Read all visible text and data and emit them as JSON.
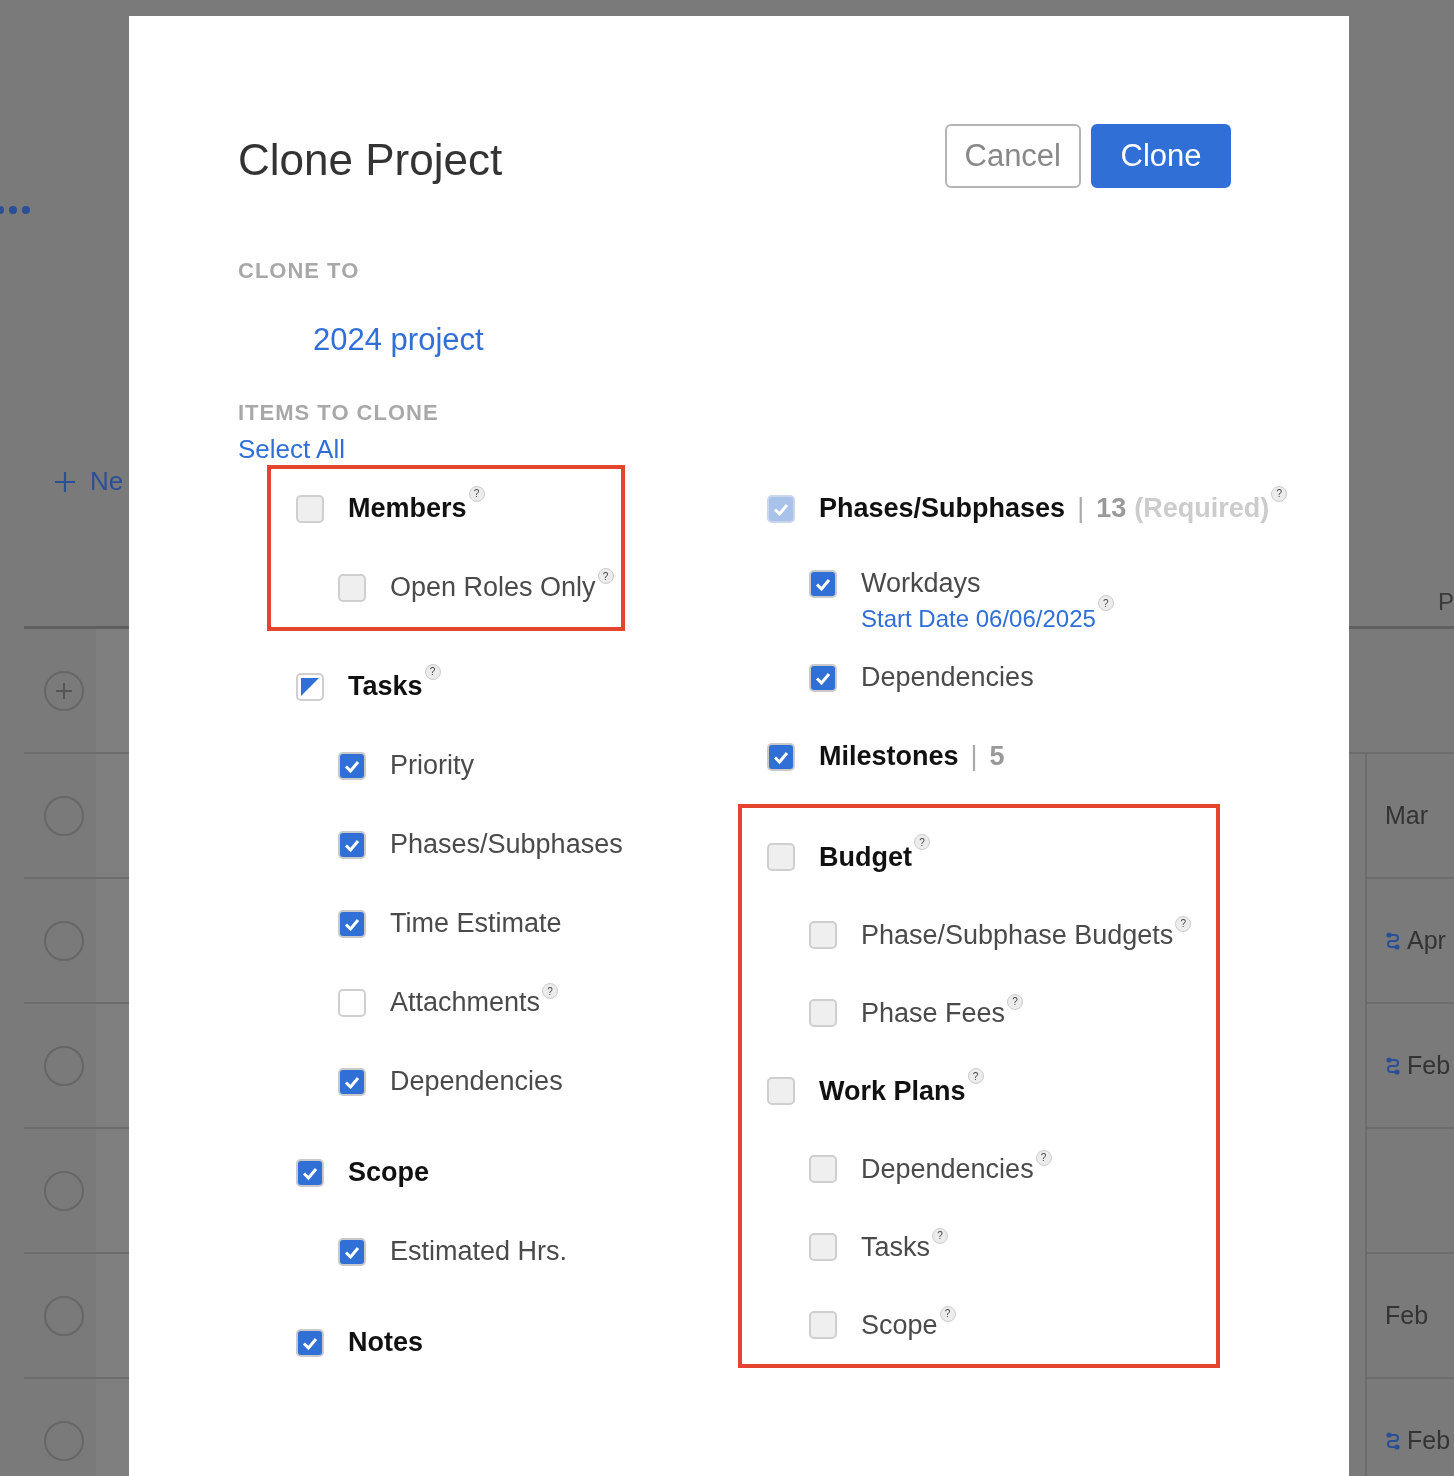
{
  "background": {
    "new_button": {
      "label": "Ne"
    },
    "column_header": "P",
    "rows": [
      {
        "add": true,
        "cell": "",
        "linked": false
      },
      {
        "add": false,
        "cell": "Mar",
        "linked": false
      },
      {
        "add": false,
        "cell": "Apr",
        "linked": true
      },
      {
        "add": false,
        "cell": "Feb",
        "linked": true
      },
      {
        "add": false,
        "cell": "",
        "linked": false
      },
      {
        "add": false,
        "cell": "Feb",
        "linked": false
      },
      {
        "add": false,
        "cell": "Feb",
        "linked": true
      }
    ]
  },
  "dialog": {
    "title": "Clone Project",
    "buttons": [
      {
        "label": "Cancel",
        "kind": "secondary"
      },
      {
        "label": "Clone",
        "kind": "primary"
      }
    ],
    "clone_to": {
      "heading": "CLONE TO",
      "value": "2024 project"
    },
    "items_heading": "ITEMS TO CLONE",
    "select_all": "Select All",
    "columns": [
      [
        {
          "highlighted": true,
          "groups": [
            {
              "label": "Members",
              "checked": false,
              "disabled": true,
              "help": "?",
              "children": [
                {
                  "label": "Open Roles Only",
                  "checked": false,
                  "disabled": true,
                  "help": "?"
                }
              ]
            }
          ]
        },
        {
          "highlighted": false,
          "groups": [
            {
              "label": "Tasks",
              "checked": true,
              "partial": true,
              "disabled": false,
              "help": "?",
              "children": [
                {
                  "label": "Priority",
                  "checked": true,
                  "disabled": false
                },
                {
                  "label": "Phases/Subphases",
                  "checked": true,
                  "disabled": false
                },
                {
                  "label": "Time Estimate",
                  "checked": true,
                  "disabled": false
                },
                {
                  "label": "Attachments",
                  "checked": false,
                  "disabled": false,
                  "help": "?"
                },
                {
                  "label": "Dependencies",
                  "checked": true,
                  "disabled": false
                }
              ]
            },
            {
              "label": "Scope",
              "checked": true,
              "disabled": false,
              "children": [
                {
                  "label": "Estimated Hrs.",
                  "checked": true,
                  "disabled": false
                }
              ]
            },
            {
              "label": "Notes",
              "checked": true,
              "disabled": false
            }
          ]
        }
      ],
      [
        {
          "highlighted": false,
          "groups": [
            {
              "label": "Phases/Subphases",
              "checked": true,
              "disabled": true,
              "separator": "|",
              "count": "13",
              "note": "(Required)",
              "help": "?",
              "children": [
                {
                  "label": "Workdays",
                  "checked": true,
                  "disabled": false,
                  "link": "Start Date 06/06/2025",
                  "link_help": "?"
                },
                {
                  "label": "Dependencies",
                  "checked": true,
                  "disabled": false
                }
              ]
            },
            {
              "label": "Milestones",
              "checked": true,
              "disabled": false,
              "separator": "|",
              "count": "5"
            }
          ]
        },
        {
          "highlighted": true,
          "groups": [
            {
              "label": "Budget",
              "checked": false,
              "disabled": true,
              "help": "?",
              "children": [
                {
                  "label": "Phase/Subphase Budgets",
                  "checked": false,
                  "disabled": true,
                  "help": "?"
                },
                {
                  "label": "Phase Fees",
                  "checked": false,
                  "disabled": true,
                  "help": "?"
                }
              ]
            },
            {
              "label": "Work Plans",
              "checked": false,
              "disabled": true,
              "help": "?",
              "children": [
                {
                  "label": "Dependencies",
                  "checked": false,
                  "disabled": true,
                  "help": "?"
                },
                {
                  "label": "Tasks",
                  "checked": false,
                  "disabled": true,
                  "help": "?"
                },
                {
                  "label": "Scope",
                  "checked": false,
                  "disabled": true,
                  "help": "?"
                }
              ]
            }
          ]
        }
      ]
    ]
  }
}
